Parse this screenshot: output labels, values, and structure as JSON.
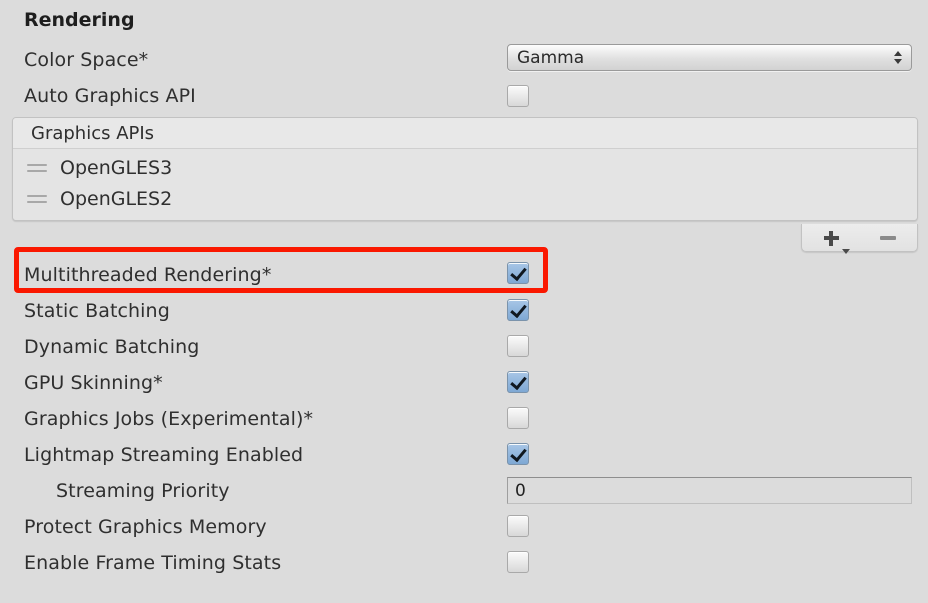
{
  "section": {
    "title": "Rendering"
  },
  "color_space": {
    "label": "Color Space*",
    "value": "Gamma"
  },
  "auto_graphics_api": {
    "label": "Auto Graphics API",
    "checked": false
  },
  "graphics_apis": {
    "header": "Graphics APIs",
    "items": [
      {
        "label": "OpenGLES3",
        "handle_icon": "drag-handle-icon"
      },
      {
        "label": "OpenGLES2",
        "handle_icon": "drag-handle-icon"
      }
    ],
    "toolbar": {
      "add_label": "+",
      "add_icon": "plus-dropdown-icon",
      "remove_label": "–",
      "remove_icon": "minus-icon"
    }
  },
  "toggles": [
    {
      "label": "Multithreaded Rendering*",
      "checked": true,
      "highlighted": true
    },
    {
      "label": "Static Batching",
      "checked": true,
      "highlighted": false
    },
    {
      "label": "Dynamic Batching",
      "checked": false,
      "highlighted": false
    },
    {
      "label": "GPU Skinning*",
      "checked": true,
      "highlighted": false
    },
    {
      "label": "Graphics Jobs (Experimental)*",
      "checked": false,
      "highlighted": false
    },
    {
      "label": "Lightmap Streaming Enabled",
      "checked": true,
      "highlighted": false
    }
  ],
  "streaming_priority": {
    "label": "Streaming Priority",
    "value": "0"
  },
  "trailing_toggles": [
    {
      "label": "Protect Graphics Memory",
      "checked": false
    },
    {
      "label": "Enable Frame Timing Stats",
      "checked": false
    }
  ],
  "colors": {
    "background": "#dcdcdc",
    "label_text": "#2f2f2f",
    "checkbox_checked_fill": "#8fb4d9",
    "checkmark": "#101820",
    "highlight_border": "#fa1800"
  }
}
